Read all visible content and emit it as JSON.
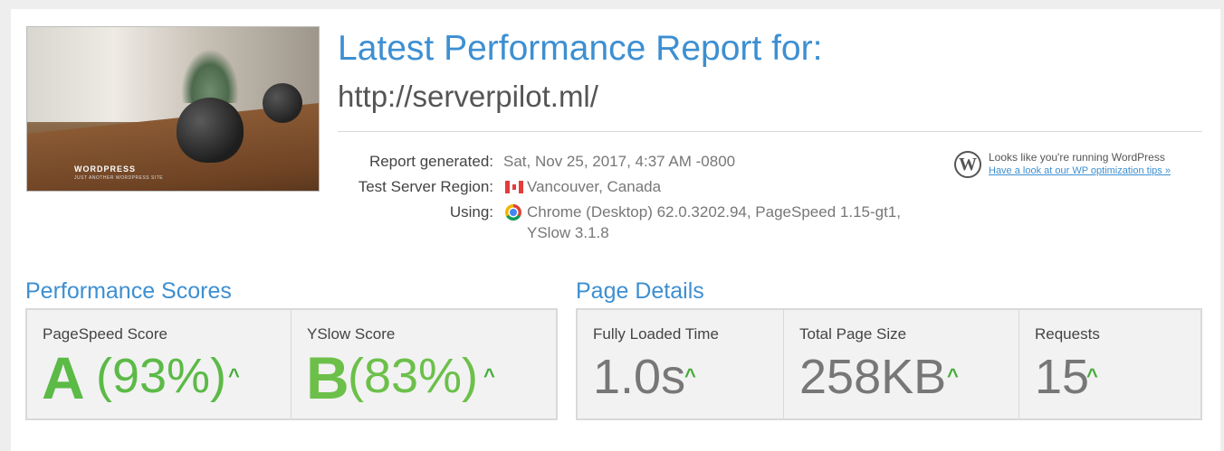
{
  "header": {
    "title": "Latest Performance Report for:",
    "url": "http://serverpilot.ml/"
  },
  "thumbnail": {
    "brand": "WORDPRESS",
    "subtitle": "JUST ANOTHER WORDPRESS SITE"
  },
  "meta": {
    "report_generated_label": "Report generated:",
    "report_generated_value": "Sat, Nov 25, 2017, 4:37 AM -0800",
    "region_label": "Test Server Region:",
    "region_value": "Vancouver, Canada",
    "region_flag_icon": "canada-flag-icon",
    "using_label": "Using:",
    "using_value_line1": "Chrome (Desktop) 62.0.3202.94, PageSpeed 1.15-gt1,",
    "using_value_line2": "YSlow 3.1.8",
    "browser_icon": "chrome-icon"
  },
  "wp_notice": {
    "text": "Looks like you're running WordPress",
    "link": "Have a look at our WP optimization tips »",
    "icon": "wordpress-icon"
  },
  "performance": {
    "title": "Performance Scores",
    "pagespeed": {
      "label": "PageSpeed Score",
      "grade": "A",
      "percent": "(93%)"
    },
    "yslow": {
      "label": "YSlow Score",
      "grade": "B",
      "percent": "(83%)"
    }
  },
  "details": {
    "title": "Page Details",
    "load_time": {
      "label": "Fully Loaded Time",
      "value": "1.0s"
    },
    "page_size": {
      "label": "Total Page Size",
      "value": "258KB"
    },
    "requests": {
      "label": "Requests",
      "value": "15"
    }
  },
  "colors": {
    "accent_blue": "#3d8fd1",
    "grade_green": "#5cba47",
    "arrow_green": "#45ad3a"
  }
}
